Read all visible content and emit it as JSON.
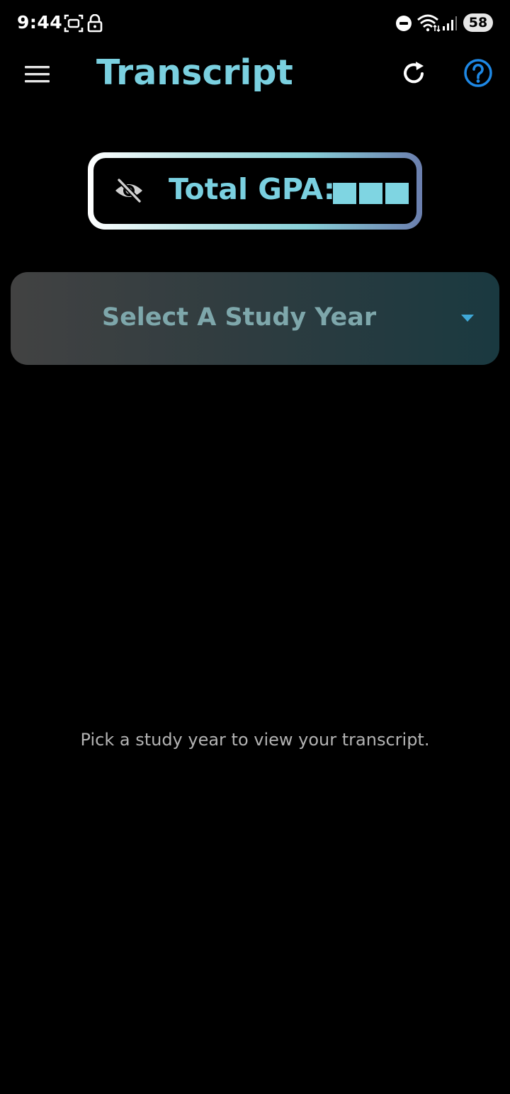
{
  "status_bar": {
    "time": "9:44",
    "battery": "58",
    "icons": [
      "screenshot-icon",
      "lock-icon",
      "do-not-disturb-icon",
      "wifi-icon",
      "signal-icon",
      "battery-icon"
    ]
  },
  "app_bar": {
    "title": "Transcript",
    "icons": [
      "menu-icon",
      "refresh-icon",
      "help-icon"
    ]
  },
  "gpa": {
    "label": "Total GPA:",
    "hidden": true,
    "masked_chars": 3,
    "icon": "eye-off-icon"
  },
  "year_select": {
    "placeholder": "Select A Study Year",
    "icon": "caret-down-icon"
  },
  "empty_state": {
    "message": "Pick a study year to view your transcript."
  },
  "colors": {
    "background": "#000000",
    "accent": "#7ad0e0",
    "help_blue": "#1e88e5",
    "select_text": "#7ea7ab",
    "muted_text": "#b3b3b3"
  }
}
